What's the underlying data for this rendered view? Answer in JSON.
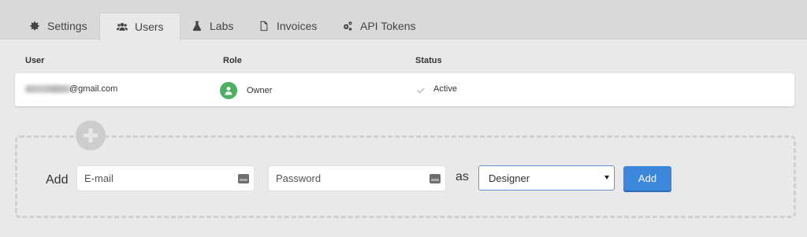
{
  "tabs": [
    {
      "label": "Settings",
      "icon": "gear-icon"
    },
    {
      "label": "Users",
      "icon": "users-icon"
    },
    {
      "label": "Labs",
      "icon": "flask-icon"
    },
    {
      "label": "Invoices",
      "icon": "document-icon"
    },
    {
      "label": "API Tokens",
      "icon": "cogs-icon"
    }
  ],
  "active_tab": "Users",
  "table": {
    "headers": {
      "user": "User",
      "role": "Role",
      "status": "Status"
    },
    "rows": [
      {
        "email_domain": "@gmail.com",
        "role": "Owner",
        "status": "Active"
      }
    ]
  },
  "add_form": {
    "add_label": "Add",
    "email_placeholder": "E-mail",
    "password_placeholder": "Password",
    "as_label": "as",
    "role_selected": "Designer",
    "button_label": "Add"
  },
  "colors": {
    "accent": "#3a87dc",
    "owner_avatar": "#4caf62",
    "tabbar_bg": "#d9d9d9",
    "page_bg": "#e9e9e9"
  }
}
